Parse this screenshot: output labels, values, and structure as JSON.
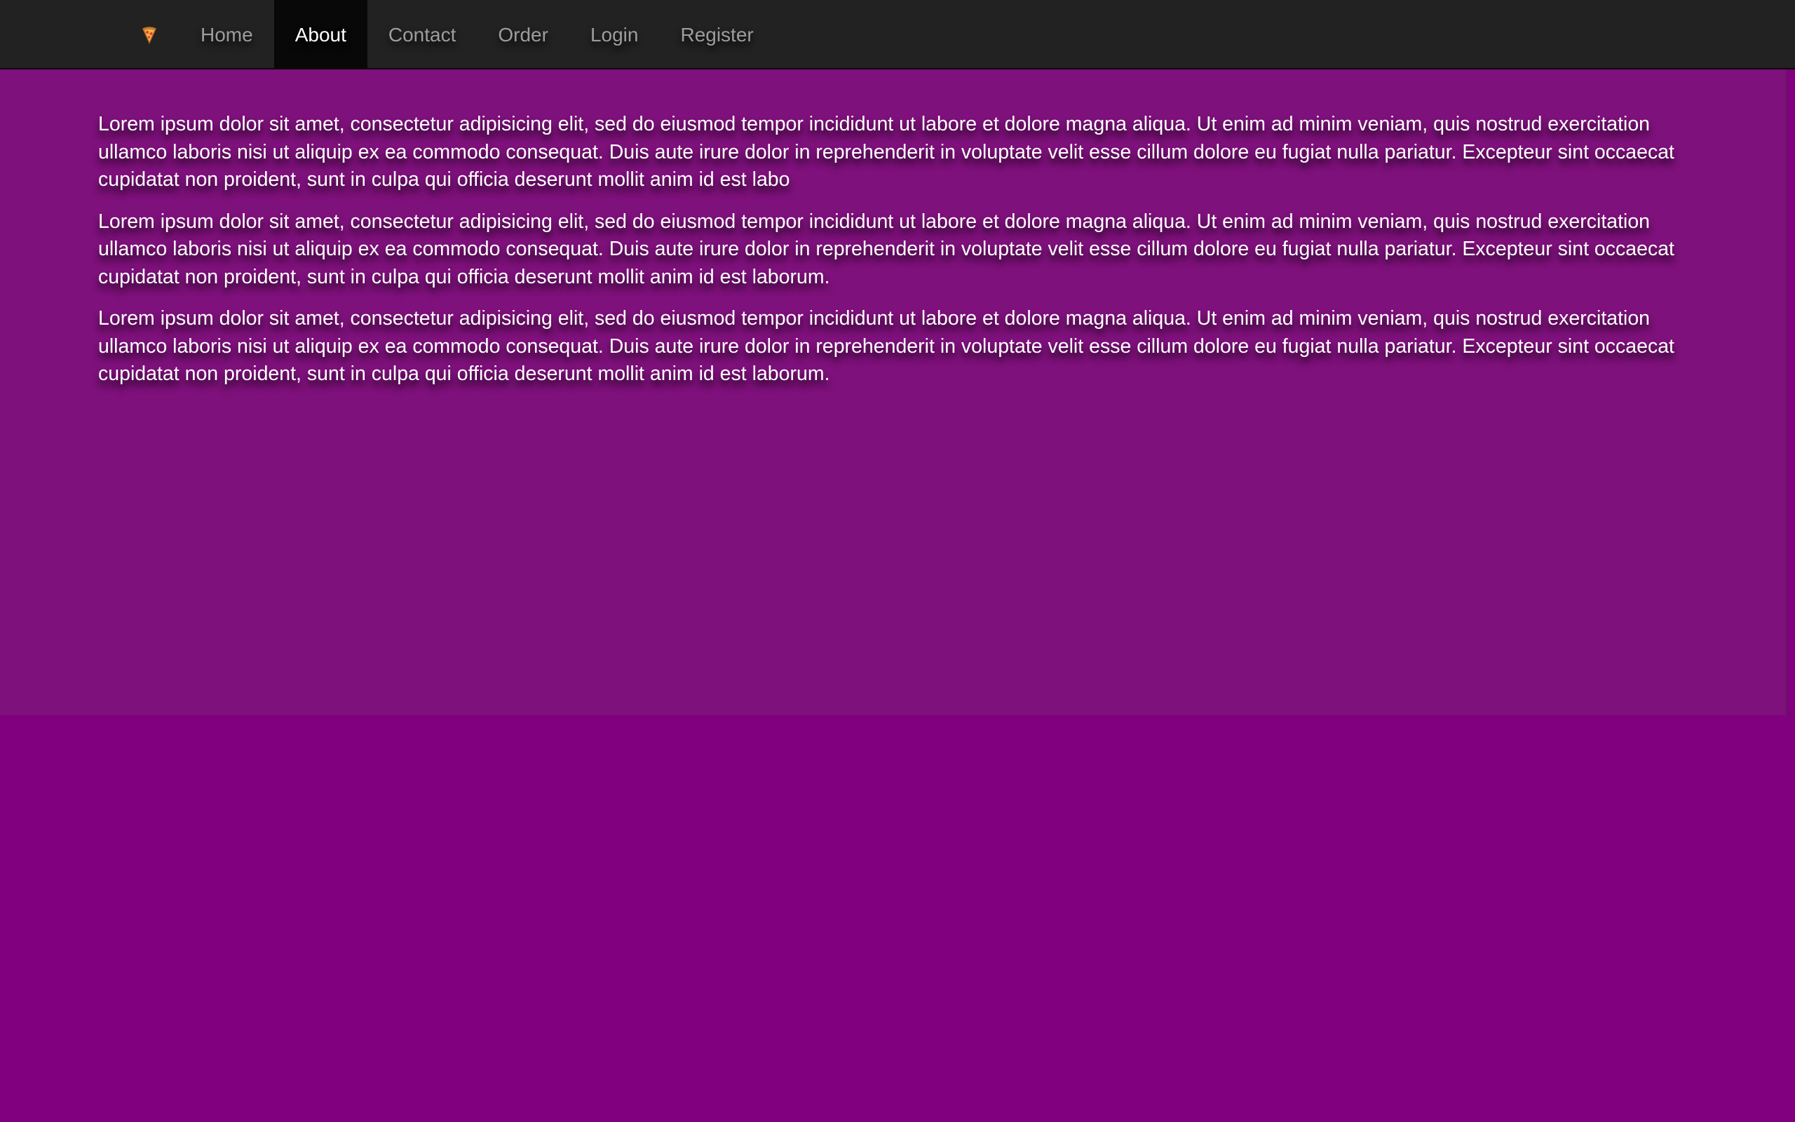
{
  "nav": {
    "brand_icon": "pizza-icon",
    "items": [
      {
        "label": "Home",
        "active": false
      },
      {
        "label": "About",
        "active": true
      },
      {
        "label": "Contact",
        "active": false
      },
      {
        "label": "Order",
        "active": false
      },
      {
        "label": "Login",
        "active": false
      },
      {
        "label": "Register",
        "active": false
      }
    ]
  },
  "main": {
    "paragraphs": [
      "Lorem ipsum dolor sit amet, consectetur adipisicing elit, sed do eiusmod tempor incididunt ut labore et dolore magna aliqua. Ut enim ad minim veniam, quis nostrud exercitation ullamco laboris nisi ut aliquip ex ea commodo consequat. Duis aute irure dolor in reprehenderit in voluptate velit esse cillum dolore eu fugiat nulla pariatur. Excepteur sint occaecat cupidatat non proident, sunt in culpa qui officia deserunt mollit anim id est labo",
      "Lorem ipsum dolor sit amet, consectetur adipisicing elit, sed do eiusmod tempor incididunt ut labore et dolore magna aliqua. Ut enim ad minim veniam, quis nostrud exercitation ullamco laboris nisi ut aliquip ex ea commodo consequat. Duis aute irure dolor in reprehenderit in voluptate velit esse cillum dolore eu fugiat nulla pariatur. Excepteur sint occaecat cupidatat non proident, sunt in culpa qui officia deserunt mollit anim id est laborum.",
      "Lorem ipsum dolor sit amet, consectetur adipisicing elit, sed do eiusmod tempor incididunt ut labore et dolore magna aliqua. Ut enim ad minim veniam, quis nostrud exercitation ullamco laboris nisi ut aliquip ex ea commodo consequat. Duis aute irure dolor in reprehenderit in voluptate velit esse cillum dolore eu fugiat nulla pariatur. Excepteur sint occaecat cupidatat non proident, sunt in culpa qui officia deserunt mollit anim id est laborum."
    ]
  },
  "colors": {
    "navbar_bg": "#222222",
    "nav_active_bg": "#080808",
    "nav_text": "#9d9d9d",
    "nav_active_text": "#ffffff",
    "page_bg": "#800080",
    "jumbotron_bg": "#7e117b",
    "body_text": "#ffffff"
  }
}
